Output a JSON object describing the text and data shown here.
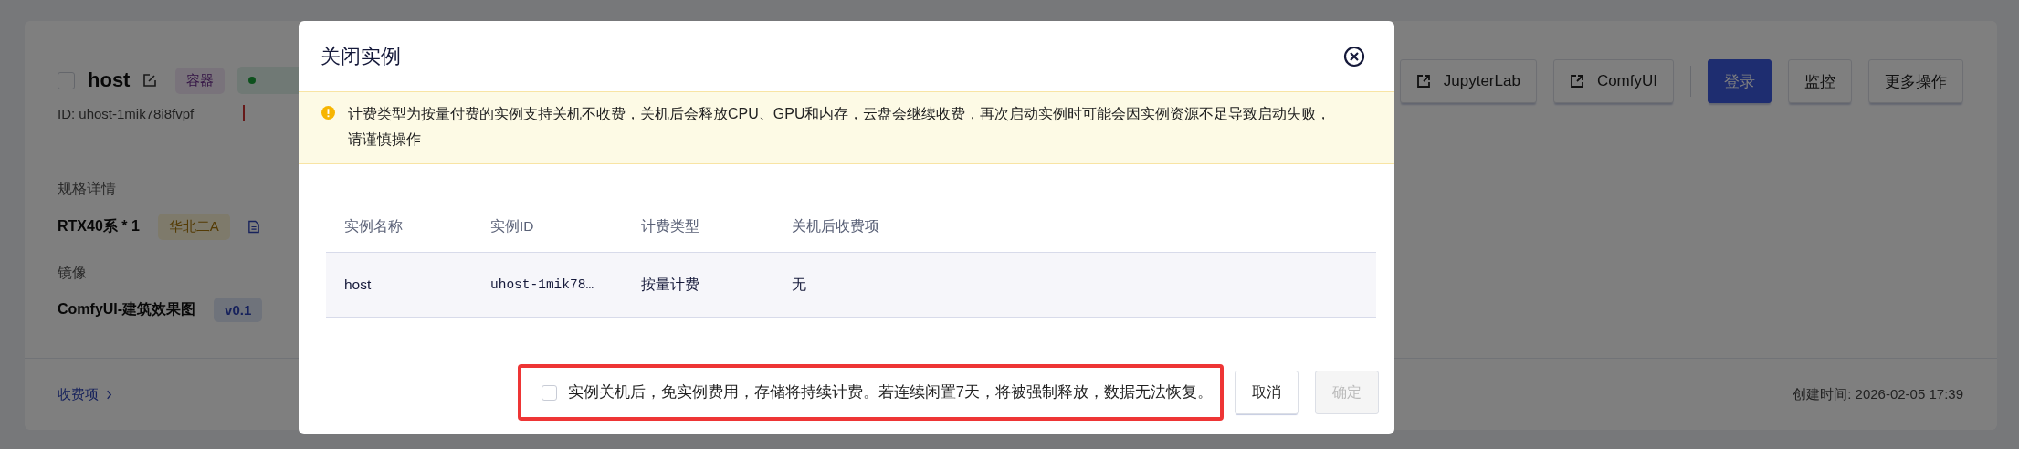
{
  "instance_card": {
    "checkbox": {
      "checked": false
    },
    "name": "host",
    "type_tag": "容器",
    "id": "ID: uhost-1mik78i8fvpf",
    "spec": {
      "label": "规格详情",
      "value": "RTX40系 * 1",
      "region": "华北二A"
    },
    "image": {
      "label": "镜像",
      "value": "ComfyUI-建筑效果图",
      "version": "v0.1"
    },
    "actions": [
      {
        "label": "JupyterLab",
        "kind": "external"
      },
      {
        "label": "ComfyUI",
        "kind": "external"
      },
      {
        "label": "登录",
        "kind": "primary"
      },
      {
        "label": "监控",
        "kind": "plain"
      },
      {
        "label": "更多操作",
        "kind": "plain"
      }
    ],
    "fees_link": "收费项",
    "created": "创建时间: 2026-02-05 17:39"
  },
  "dialog": {
    "title": "关闭实例",
    "warning": "计费类型为按量付费的实例支持关机不收费，关机后会释放CPU、GPU和内存，云盘会继续收费，再次启动实例时可能会因实例资源不足导致启动失败，请谨慎操作",
    "table": {
      "columns": [
        "实例名称",
        "实例ID",
        "计费类型",
        "关机后收费项"
      ],
      "rows": [
        [
          "host",
          "uhost-1mik78…",
          "按量计费",
          "无"
        ]
      ]
    },
    "consent": {
      "checked": false,
      "highlighted": true,
      "text": "实例关机后，免实例费用，存储将持续计费。若连续闲置7天，将被强制释放，数据无法恢复。"
    },
    "buttons": [
      {
        "label": "取消",
        "disabled": false
      },
      {
        "label": "确定",
        "disabled": true
      }
    ]
  }
}
